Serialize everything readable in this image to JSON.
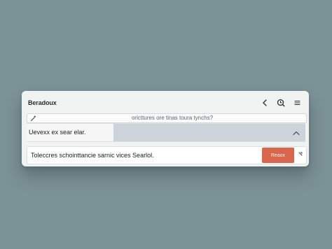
{
  "window": {
    "title": "Beradoux"
  },
  "header": {
    "back_icon": "chevron-left-icon",
    "search_icon": "search-icon",
    "menu_icon": "menu-icon"
  },
  "search": {
    "icon": "wand-icon",
    "placeholder": "oricttures ore tinas toura tynchs?"
  },
  "list": {
    "row_label": "Uevexx ex sear elar.",
    "chevron_icon": "chevron-up-icon"
  },
  "action": {
    "label": "Toleccres schointtancie sarnic vices Searlol.",
    "button_label": "Reaox",
    "collapse_icon": "collapse-icon"
  },
  "colors": {
    "background": "#7b9296",
    "window": "#f1f2f2",
    "highlight": "#ccd3da",
    "accent": "#d9654c"
  }
}
